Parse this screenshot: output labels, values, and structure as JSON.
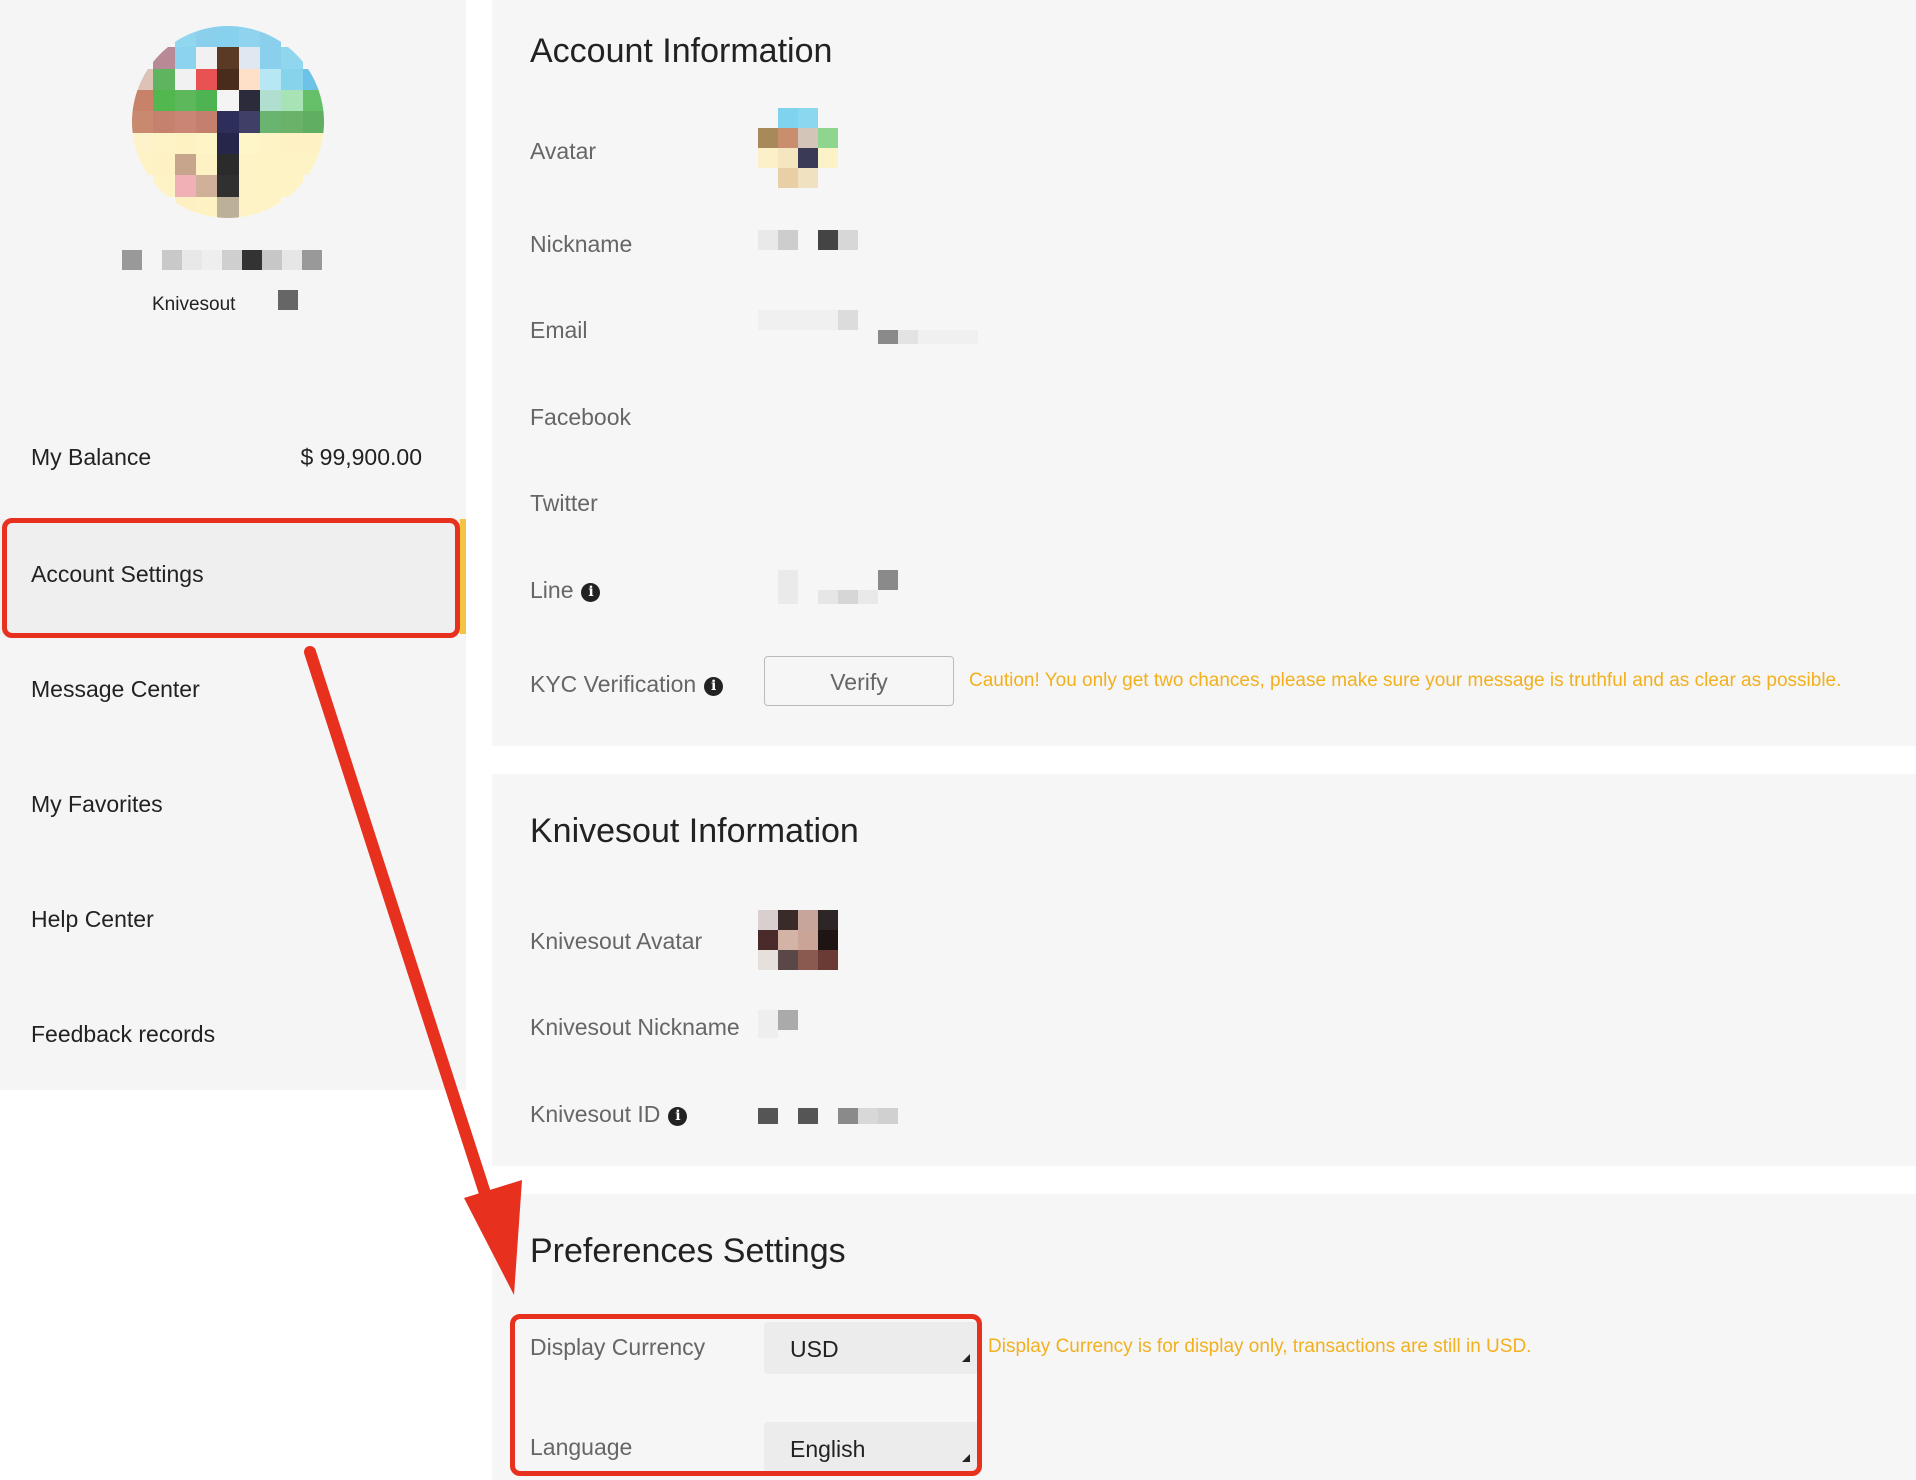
{
  "sidebar": {
    "profile": {
      "name": "Knivesout"
    },
    "balance": {
      "label": "My Balance",
      "value": "$ 99,900.00"
    },
    "items": [
      {
        "label": "Account Settings",
        "active": true
      },
      {
        "label": "Message Center"
      },
      {
        "label": "My Favorites"
      },
      {
        "label": "Help Center"
      },
      {
        "label": "Feedback records"
      }
    ]
  },
  "account": {
    "title": "Account Information",
    "avatar_label": "Avatar",
    "nickname_label": "Nickname",
    "email_label": "Email",
    "facebook_label": "Facebook",
    "twitter_label": "Twitter",
    "line_label": "Line",
    "kyc_label": "KYC Verification",
    "verify_button": "Verify",
    "caution": "Caution! You only get two chances, please make sure your message is truthful and as clear as possible."
  },
  "knivesout": {
    "title": "Knivesout Information",
    "avatar_label": "Knivesout Avatar",
    "nickname_label": "Knivesout Nickname",
    "id_label": "Knivesout ID"
  },
  "preferences": {
    "title": "Preferences Settings",
    "currency_label": "Display Currency",
    "currency_value": "USD",
    "currency_note": "Display Currency is for display only, transactions are still in USD.",
    "language_label": "Language",
    "language_value": "English"
  },
  "colors": {
    "accent": "#f6c443",
    "warning": "#f2b01e",
    "annotation": "#e8301f"
  },
  "icons": {
    "info": "info-icon",
    "caret": "caret-down-icon"
  }
}
